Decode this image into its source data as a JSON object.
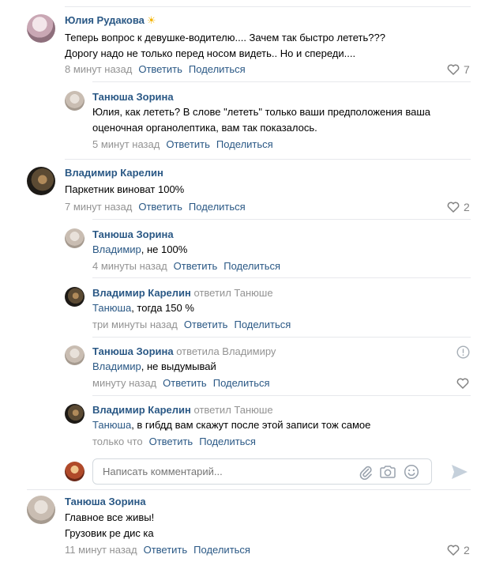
{
  "comments": [
    {
      "author": "Юлия Рудакова",
      "emoji": "☀",
      "lines": [
        "Теперь вопрос к девушке-водителю.... Зачем так быстро лететь???",
        "Дорогу надо не только перед носом видеть.. Но и спереди...."
      ],
      "time": "8 минут назад",
      "reply": "Ответить",
      "share": "Поделиться",
      "likes": "7"
    },
    {
      "author": "Танюша Зорина",
      "lines": [
        "Юлия, как лететь? В слове \"лететь\" только ваши предположения ваша",
        "оценочная органолептика, вам так показалось."
      ],
      "time": "5 минут назад",
      "reply": "Ответить",
      "share": "Поделиться"
    },
    {
      "author": "Владимир Карелин",
      "lines": [
        "Паркетник виноват 100%"
      ],
      "time": "7 минут назад",
      "reply": "Ответить",
      "share": "Поделиться",
      "likes": "2"
    },
    {
      "author": "Танюша Зорина",
      "addressee": "Владимир",
      "rest": ", не 100%",
      "time": "4 минуты назад",
      "reply": "Ответить",
      "share": "Поделиться"
    },
    {
      "author": "Владимир Карелин",
      "replied": "ответил Танюше",
      "addressee": "Танюша",
      "rest": ", тогда 150 %",
      "time": "три минуты назад",
      "reply": "Ответить",
      "share": "Поделиться"
    },
    {
      "author": "Танюша Зорина",
      "replied": "ответила Владимиру",
      "addressee": "Владимир",
      "rest": ", не выдумывай",
      "time": "минуту назад",
      "reply": "Ответить",
      "share": "Поделиться"
    },
    {
      "author": "Владимир Карелин",
      "replied": "ответил Танюше",
      "addressee": "Танюша",
      "rest": ", в гибдд вам скажут после этой записи тож самое",
      "time": "только что",
      "reply": "Ответить",
      "share": "Поделиться"
    },
    {
      "author": "Танюша Зорина",
      "lines": [
        "Главное все живы!",
        "Грузовик ре дис ка"
      ],
      "time": "11 минут назад",
      "reply": "Ответить",
      "share": "Поделиться",
      "likes": "2"
    }
  ],
  "composer": {
    "placeholder": "Написать комментарий..."
  },
  "icons": {
    "like": "heart-icon",
    "report": "exclamation-circle-icon",
    "attach": "paperclip-icon",
    "photo": "camera-icon",
    "emoji": "smiley-icon",
    "send": "send-arrow-icon"
  },
  "colors": {
    "link": "#2a5885",
    "muted": "#939393",
    "divider": "#e7e8ec"
  }
}
